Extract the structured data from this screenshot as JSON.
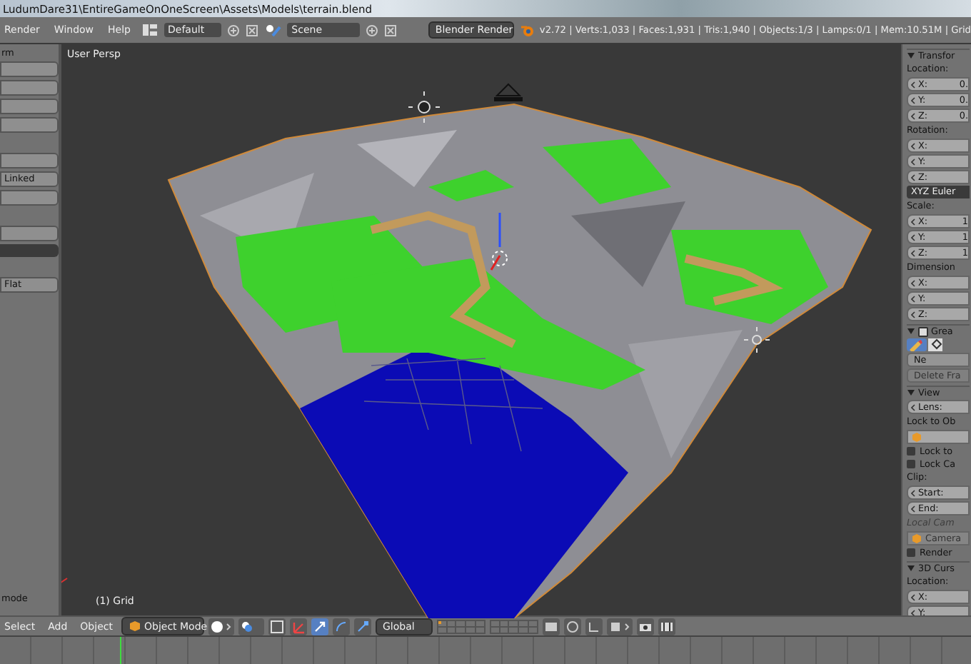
{
  "window": {
    "title": "LudumDare31\\EntireGameOnOneScreen\\Assets\\Models\\terrain.blend"
  },
  "info_header": {
    "menus": [
      "Render",
      "Window",
      "Help"
    ],
    "screen_layout": "Default",
    "scene": "Scene",
    "render_engine": "Blender Render",
    "stats": "v2.72 | Verts:1,033 | Faces:1,931 | Tris:1,940 | Objects:1/3 | Lamps:0/1 | Mem:10.51M | Grid"
  },
  "tool_shelf": {
    "items": [
      {
        "kind": "label",
        "text": "rm"
      },
      {
        "kind": "button"
      },
      {
        "kind": "button"
      },
      {
        "kind": "button"
      },
      {
        "kind": "button"
      },
      {
        "kind": "gap"
      },
      {
        "kind": "button"
      },
      {
        "kind": "button",
        "text": "Linked"
      },
      {
        "kind": "button"
      },
      {
        "kind": "gap"
      },
      {
        "kind": "button"
      },
      {
        "kind": "dropdown"
      },
      {
        "kind": "gap"
      },
      {
        "kind": "button",
        "text": "Flat"
      }
    ],
    "bottom_label": "mode"
  },
  "viewport": {
    "view_name": "User Persp",
    "object_info": "(1) Grid"
  },
  "properties": {
    "items": [
      {
        "kind": "header",
        "text": "Transfor"
      },
      {
        "kind": "label",
        "text": "Location:"
      },
      {
        "kind": "field",
        "text": "X:",
        "value": "0."
      },
      {
        "kind": "field",
        "text": "Y:",
        "value": "0."
      },
      {
        "kind": "field",
        "text": "Z:",
        "value": "0."
      },
      {
        "kind": "label",
        "text": "Rotation:"
      },
      {
        "kind": "field",
        "text": "X:"
      },
      {
        "kind": "field",
        "text": "Y:"
      },
      {
        "kind": "field",
        "text": "Z:"
      },
      {
        "kind": "dropdown",
        "text": "XYZ Euler"
      },
      {
        "kind": "label",
        "text": "Scale:"
      },
      {
        "kind": "field",
        "text": "X:",
        "value": "1"
      },
      {
        "kind": "field",
        "text": "Y:",
        "value": "1"
      },
      {
        "kind": "field",
        "text": "Z:",
        "value": "1"
      },
      {
        "kind": "label",
        "text": "Dimension"
      },
      {
        "kind": "field",
        "text": "X:"
      },
      {
        "kind": "field",
        "text": "Y:"
      },
      {
        "kind": "field",
        "text": "Z:"
      },
      {
        "kind": "header",
        "text": "Grea",
        "checked": true
      },
      {
        "kind": "tools"
      },
      {
        "kind": "button",
        "text": "Ne"
      },
      {
        "kind": "button",
        "text": "Delete Fra",
        "disabled": true
      },
      {
        "kind": "header",
        "text": "View"
      },
      {
        "kind": "field",
        "text": "Lens:"
      },
      {
        "kind": "label",
        "text": "Lock to Ob"
      },
      {
        "kind": "objfield"
      },
      {
        "kind": "check",
        "text": "Lock to",
        "checked": false
      },
      {
        "kind": "check",
        "text": "Lock Ca",
        "checked": false
      },
      {
        "kind": "label",
        "text": "Clip:"
      },
      {
        "kind": "field",
        "text": "Start:"
      },
      {
        "kind": "field",
        "text": "End:"
      },
      {
        "kind": "label",
        "text": "Local Cam",
        "disabled": true
      },
      {
        "kind": "objfield",
        "text": "Camera",
        "disabled": true
      },
      {
        "kind": "check",
        "text": "Render",
        "checked": false
      },
      {
        "kind": "header",
        "text": "3D Curs"
      },
      {
        "kind": "label",
        "text": "Location:"
      },
      {
        "kind": "field",
        "text": "X:"
      },
      {
        "kind": "field",
        "text": "Y:"
      }
    ]
  },
  "view3d_header": {
    "menus": [
      "Select",
      "Add",
      "Object"
    ],
    "mode": "Object Mode",
    "orientation": "Global"
  }
}
